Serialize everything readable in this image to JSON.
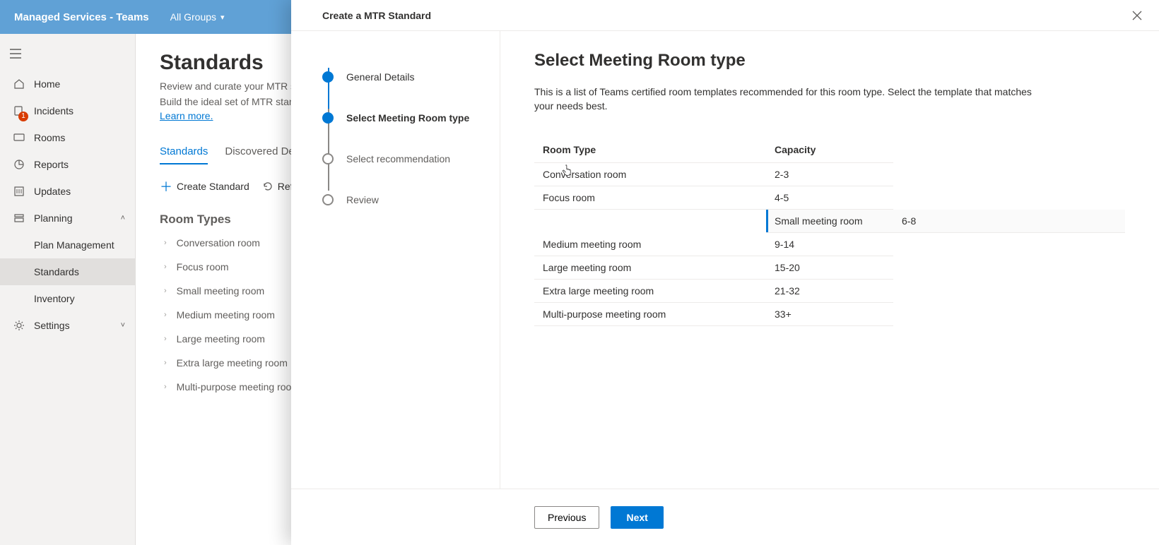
{
  "topbar": {
    "title": "Managed Services - Teams",
    "groups_label": "All Groups"
  },
  "sidebar": {
    "items": [
      {
        "label": "Home"
      },
      {
        "label": "Incidents",
        "badge": "1"
      },
      {
        "label": "Rooms"
      },
      {
        "label": "Reports"
      },
      {
        "label": "Updates"
      },
      {
        "label": "Planning",
        "expanded": true
      },
      {
        "label": "Settings"
      }
    ],
    "planning_children": [
      {
        "label": "Plan Management"
      },
      {
        "label": "Standards",
        "active": true
      },
      {
        "label": "Inventory"
      }
    ]
  },
  "main": {
    "heading": "Standards",
    "subtitle_line1": "Review and curate your MTR standards.",
    "subtitle_line2": "Build the ideal set of MTR standards.",
    "learn_more": "Learn more.",
    "tabs": [
      {
        "label": "Standards",
        "active": true
      },
      {
        "label": "Discovered Devices"
      }
    ],
    "toolbar": {
      "create_label": "Create Standard",
      "refresh_label": "Refresh"
    },
    "room_types_heading": "Room Types",
    "room_types": [
      "Conversation room",
      "Focus room",
      "Small meeting room",
      "Medium meeting room",
      "Large meeting room",
      "Extra large meeting room",
      "Multi-purpose meeting room"
    ]
  },
  "dialog": {
    "title": "Create a MTR Standard",
    "steps": [
      {
        "label": "General Details",
        "state": "completed"
      },
      {
        "label": "Select Meeting Room type",
        "state": "current"
      },
      {
        "label": "Select recommendation",
        "state": "upcoming"
      },
      {
        "label": "Review",
        "state": "upcoming"
      }
    ],
    "content": {
      "heading": "Select Meeting Room type",
      "description": "This is a list of Teams certified room templates recommended for this room type. Select the template that matches your needs best.",
      "columns": {
        "type": "Room Type",
        "capacity": "Capacity"
      },
      "rows": [
        {
          "type": "Conversation room",
          "capacity": "2-3"
        },
        {
          "type": "Focus room",
          "capacity": "4-5"
        },
        {
          "type": "Small meeting room",
          "capacity": "6-8",
          "selected": true
        },
        {
          "type": "Medium meeting room",
          "capacity": "9-14"
        },
        {
          "type": "Large meeting room",
          "capacity": "15-20"
        },
        {
          "type": "Extra large meeting room",
          "capacity": "21-32"
        },
        {
          "type": "Multi-purpose meeting room",
          "capacity": "33+"
        }
      ]
    },
    "footer": {
      "previous": "Previous",
      "next": "Next"
    }
  }
}
